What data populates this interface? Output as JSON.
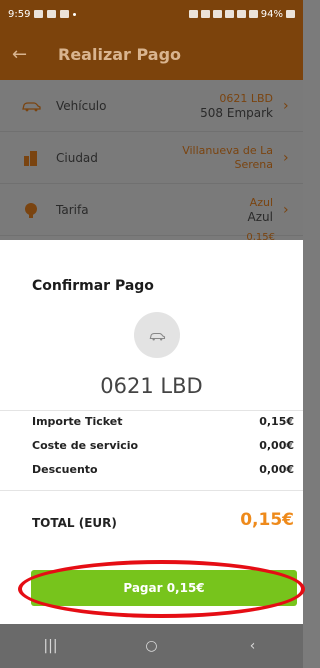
{
  "status_bar": {
    "time": "9:59",
    "battery": "94%"
  },
  "header": {
    "title": "Realizar Pago",
    "back_icon": "arrow-left-icon"
  },
  "list": {
    "rows": [
      {
        "label": "Vehículo",
        "value1": "0621 LBD",
        "value2": "508 Empark",
        "icon": "car-icon"
      },
      {
        "label": "Ciudad",
        "value1": "Villanueva de La",
        "value2": "Serena",
        "icon": "city-icon"
      },
      {
        "label": "Tarifa",
        "value1": "Azul",
        "value2": "Azul",
        "icon": "tariff-icon"
      }
    ],
    "peek_value": "0,15€"
  },
  "sheet": {
    "title": "Confirmar Pago",
    "plate": "0621 LBD",
    "summary": [
      {
        "label": "Importe Ticket",
        "amount": "0,15€"
      },
      {
        "label": "Coste de servicio",
        "amount": "0,00€"
      },
      {
        "label": "Descuento",
        "amount": "0,00€"
      }
    ],
    "total_label": "TOTAL (EUR)",
    "total_amount": "0,15€",
    "pay_button": "Pagar 0,15€"
  },
  "nav": {
    "recent": "|||",
    "home": "○",
    "back": "‹"
  },
  "colors": {
    "brand": "#7c430c",
    "accent": "#ee8a1b",
    "pay": "#77c41c",
    "highlight": "#e50d14"
  }
}
